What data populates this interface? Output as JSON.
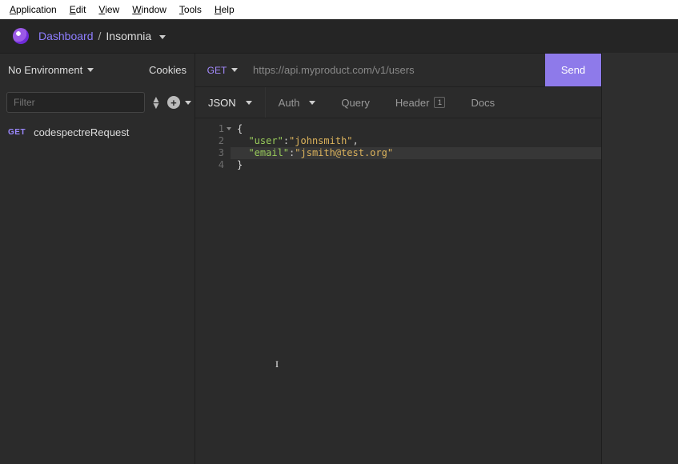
{
  "menu": {
    "items": [
      {
        "u": "A",
        "rest": "pplication"
      },
      {
        "u": "E",
        "rest": "dit"
      },
      {
        "u": "V",
        "rest": "iew"
      },
      {
        "u": "W",
        "rest": "indow"
      },
      {
        "u": "T",
        "rest": "ools"
      },
      {
        "u": "H",
        "rest": "elp"
      }
    ]
  },
  "header": {
    "dashboard": "Dashboard",
    "sep": "/",
    "workspace": "Insomnia"
  },
  "sidebar": {
    "env_label": "No Environment",
    "cookies_label": "Cookies",
    "filter_placeholder": "Filter",
    "entries": [
      {
        "method": "GET",
        "name": "codespectreRequest"
      }
    ]
  },
  "url_row": {
    "method": "GET",
    "url": "https://api.myproduct.com/v1/users",
    "send": "Send"
  },
  "tabs": {
    "body": "JSON",
    "auth": "Auth",
    "query": "Query",
    "header": "Header",
    "header_count": "1",
    "docs": "Docs"
  },
  "editor": {
    "lines": [
      "1",
      "2",
      "3",
      "4"
    ],
    "l1": "{",
    "l2_key": "\"user\"",
    "l2_val": "\"johnsmith\"",
    "l2_trail": ",",
    "l3_key": "\"email\"",
    "l3_val": "\"jsmith@test.org\"",
    "l4": "}"
  }
}
